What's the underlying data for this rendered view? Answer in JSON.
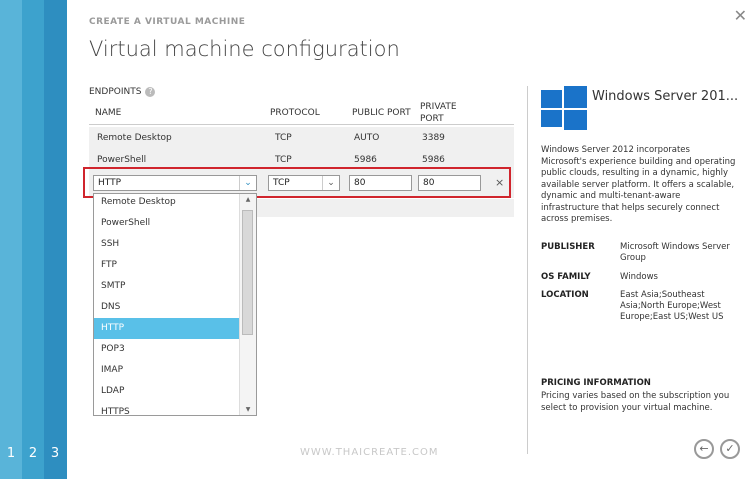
{
  "wizard": {
    "label": "CREATE A VIRTUAL MACHINE",
    "title": "Virtual machine configuration",
    "steps": [
      "1",
      "2",
      "3"
    ]
  },
  "endpoints": {
    "heading": "ENDPOINTS",
    "columns": {
      "name": "NAME",
      "protocol": "PROTOCOL",
      "public_port": "PUBLIC PORT",
      "private_port_1": "PRIVATE",
      "private_port_2": "PORT"
    },
    "rows": [
      {
        "name": "Remote Desktop",
        "protocol": "TCP",
        "public_port": "AUTO",
        "private_port": "3389"
      },
      {
        "name": "PowerShell",
        "protocol": "TCP",
        "public_port": "5986",
        "private_port": "5986"
      }
    ],
    "new_row": {
      "name": "HTTP",
      "protocol": "TCP",
      "public_port": "80",
      "private_port": "80",
      "remove": "×"
    }
  },
  "dropdown": {
    "options": [
      "Remote Desktop",
      "PowerShell",
      "SSH",
      "FTP",
      "SMTP",
      "DNS",
      "HTTP",
      "POP3",
      "IMAP",
      "LDAP",
      "HTTPS"
    ],
    "selected": "HTTP"
  },
  "image_info": {
    "title": "Windows Server 201...",
    "description": "Windows Server 2012 incorporates Microsoft's experience building and operating public clouds, resulting in a dynamic, highly available server platform. It offers a scalable, dynamic and multi-tenant-aware infrastructure that helps securely connect across premises.",
    "publisher_label": "PUBLISHER",
    "publisher_value": "Microsoft Windows Server Group",
    "os_family_label": "OS FAMILY",
    "os_family_value": "Windows",
    "location_label": "LOCATION",
    "location_value": "East Asia;Southeast Asia;North Europe;West Europe;East US;West US",
    "pricing_label": "PRICING INFORMATION",
    "pricing_text": "Pricing varies based on the subscription you select to provision your virtual machine."
  },
  "footer": {
    "watermark": "WWW.THAICREATE.COM",
    "back": "←",
    "finish": "✓"
  },
  "colors": {
    "accent": "#59b4d9",
    "highlight_border": "#d0252d",
    "selected_option": "#59c0e8"
  }
}
